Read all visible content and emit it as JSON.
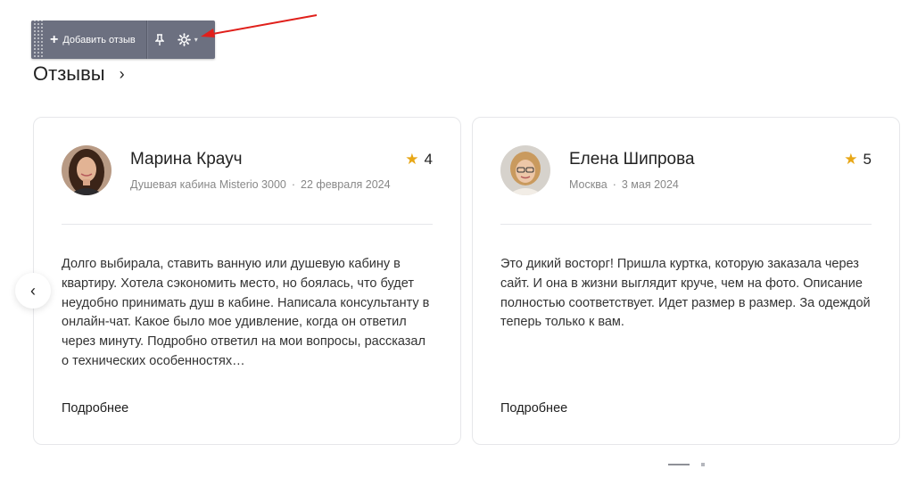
{
  "toolbar": {
    "add_label": "Добавить отзыв",
    "plus_glyph": "+",
    "pin_icon": "pin-icon",
    "gear_icon": "gear-icon",
    "caret_glyph": "▾"
  },
  "section": {
    "title": "Отзывы",
    "chevron": "›"
  },
  "reviews": [
    {
      "author": "Марина Крауч",
      "product": "Душевая кабина Misterio 3000",
      "date": "22 февраля 2024",
      "rating": "4",
      "text": "Долго выбирала, ставить ванную или душевую кабину в квартиру. Хотела сэкономить место, но боялась, что будет неудобно принимать душ в кабине. Написала консультанту в онлайн-чат. Какое было мое удивление, когда он ответил через минуту. Подробно ответил на мои вопросы, рассказал о технических особенностях…",
      "more_label": "Подробнее"
    },
    {
      "author": "Елена Шипрова",
      "product": "Москва",
      "date": "3 мая 2024",
      "rating": "5",
      "text": "Это дикий восторг! Пришла куртка, которую заказала через сайт. И она в жизни выглядит круче, чем на фото. Описание полностью соответствует. Идет размер в размер. За одеждой теперь только к вам.",
      "more_label": "Подробнее"
    }
  ],
  "meta_separator": "·",
  "star_glyph": "★",
  "prev_glyph": "‹",
  "colors": {
    "toolbar_bg": "#6c7080",
    "star": "#e8a716",
    "arrow": "#e0201b"
  }
}
